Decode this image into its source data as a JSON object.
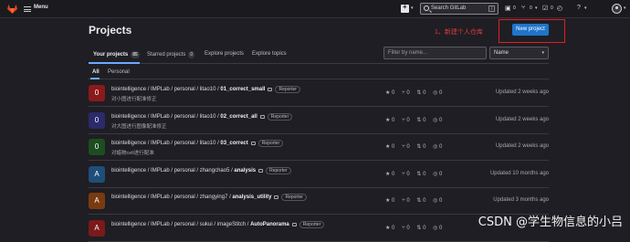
{
  "topbar": {
    "menu_label": "Menu",
    "search_placeholder": "Search GitLab",
    "search_shortcut": "/",
    "issues_count": "0",
    "mr_count": "0",
    "todo_count": "0"
  },
  "page": {
    "title": "Projects",
    "new_project_label": "New project",
    "annotation": "1、新建个人仓库"
  },
  "tabs": {
    "your_projects": "Your projects",
    "your_projects_count": "85",
    "starred_projects": "Starred projects",
    "starred_count": "0",
    "explore_projects": "Explore projects",
    "explore_topics": "Explore topics"
  },
  "filter": {
    "placeholder": "Filter by name...",
    "sort_value": "Name"
  },
  "subtabs": {
    "all": "All",
    "personal": "Personal"
  },
  "projects": [
    {
      "initial": "0",
      "color": "#8b1a1a",
      "path": "biointelligence / IMPLab / personal / litao10 / ",
      "name": "01_correct_small",
      "role": "Reporter",
      "desc": "对小图进行配准修正",
      "stars": "0",
      "forks": "0",
      "mrs": "0",
      "issues": "0",
      "updated": "Updated 2 weeks ago"
    },
    {
      "initial": "0",
      "color": "#2b2a6b",
      "path": "biointelligence / IMPLab / personal / litao10 / ",
      "name": "02_correct_all",
      "role": "Reporter",
      "desc": "对大图进行图像配准修正",
      "stars": "0",
      "forks": "0",
      "mrs": "0",
      "issues": "0",
      "updated": "Updated 2 weeks ago"
    },
    {
      "initial": "0",
      "color": "#1d4d1f",
      "path": "biointelligence / IMPLab / personal / litao10 / ",
      "name": "03_correct",
      "role": "Reporter",
      "desc": "对蜡物cell进行配准",
      "stars": "0",
      "forks": "0",
      "mrs": "0",
      "issues": "0",
      "updated": "Updated 2 weeks ago"
    },
    {
      "initial": "A",
      "color": "#1e4e7a",
      "path": "biointelligence / IMPLab / personal / zhangchao5 / ",
      "name": "analysis",
      "role": "Reporter",
      "desc": "",
      "stars": "0",
      "forks": "0",
      "mrs": "0",
      "issues": "0",
      "updated": "Updated 10 months ago"
    },
    {
      "initial": "A",
      "color": "#7a3a10",
      "path": "biointelligence / IMPLab / personal / zhangying7 / ",
      "name": "analysis_utility",
      "role": "Reporter",
      "desc": "",
      "stars": "0",
      "forks": "0",
      "mrs": "0",
      "issues": "0",
      "updated": "Updated 3 months ago"
    },
    {
      "initial": "A",
      "color": "#7a1a1a",
      "path": "biointelligence / IMPLab / personal / sukui / imageStitch / ",
      "name": "AutoPanorama",
      "role": "Reporter",
      "desc": "",
      "stars": "0",
      "forks": "0",
      "mrs": "0",
      "issues": "0",
      "updated": ""
    }
  ],
  "watermark": "CSDN @学生物信息的小吕"
}
